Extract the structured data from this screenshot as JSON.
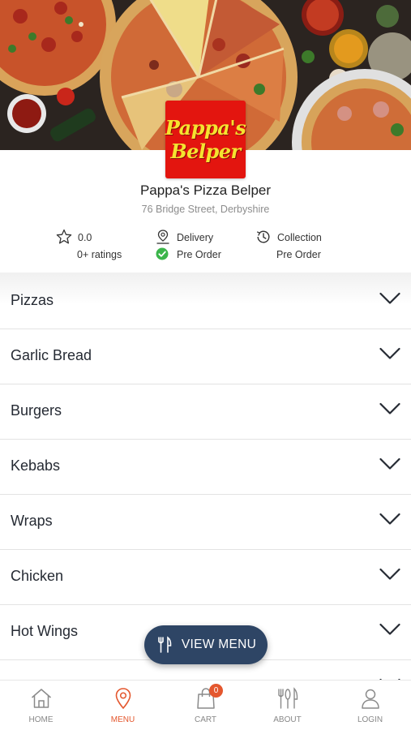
{
  "restaurant": {
    "logo_line1": "Pappa's",
    "logo_line2": "Belper",
    "name": "Pappa's Pizza Belper",
    "address": "76 Bridge Street, Derbyshire"
  },
  "stats": {
    "rating_value": "0.0",
    "rating_count": "0+ ratings",
    "delivery_label": "Delivery",
    "delivery_status": "Pre Order",
    "collection_label": "Collection",
    "collection_status": "Pre Order"
  },
  "categories": [
    {
      "label": "Pizzas"
    },
    {
      "label": "Garlic Bread"
    },
    {
      "label": "Burgers"
    },
    {
      "label": "Kebabs"
    },
    {
      "label": "Wraps"
    },
    {
      "label": "Chicken"
    },
    {
      "label": "Hot Wings"
    }
  ],
  "view_menu_label": "VIEW MENU",
  "nav": {
    "home": "HOME",
    "menu": "MENU",
    "cart": "CART",
    "cart_count": "0",
    "about": "ABOUT",
    "login": "LOGIN",
    "active": "menu"
  },
  "colors": {
    "accent": "#e4572e",
    "button": "#2e4565",
    "logo_bg": "#e3150f",
    "logo_text": "#f5e330",
    "success": "#3bb54a"
  },
  "icons": {
    "hero": "pizza-banner-image",
    "rating": "star-icon",
    "delivery": "location-pin-icon",
    "collection": "clock-history-icon",
    "pre_order_check": "check-circle-icon",
    "category_toggle": "chevron-down-icon",
    "view_menu": "cutlery-icon",
    "nav_home": "home-icon",
    "nav_menu": "map-pin-icon",
    "nav_cart": "shopping-bag-icon",
    "nav_about": "cutlery-icon",
    "nav_login": "user-icon"
  }
}
